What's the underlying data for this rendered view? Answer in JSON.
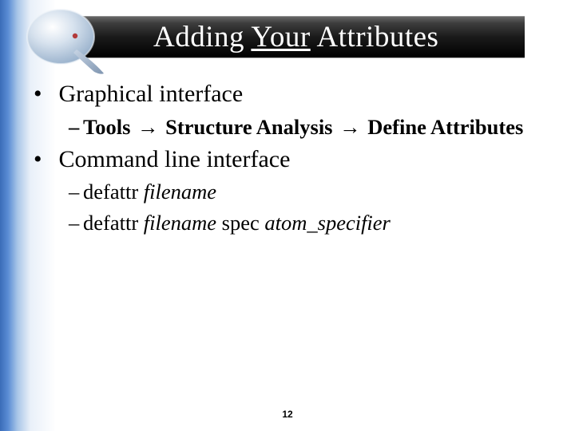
{
  "title": {
    "w1": "Adding",
    "w2": "Your",
    "w3": "Attributes"
  },
  "b1": "Graphical interface",
  "b1s1": {
    "a": "Tools",
    "b": "Structure Analysis",
    "c": "Define Attributes",
    "arrow": "→"
  },
  "b2": "Command line interface",
  "b2s1": {
    "cmd": "defattr",
    "arg": "filename"
  },
  "b2s2": {
    "cmd": "defattr",
    "arg1": "filename",
    "word": "spec",
    "arg2": "atom_specifier"
  },
  "dash": "–",
  "page": "12"
}
